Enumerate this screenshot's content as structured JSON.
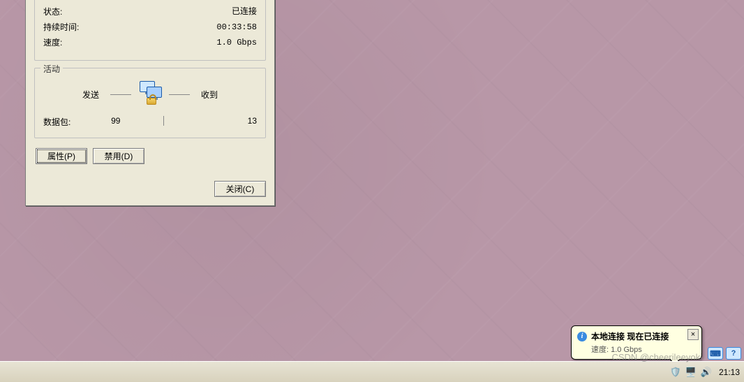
{
  "dialog": {
    "status_group": {
      "rows": {
        "status": {
          "label": "状态:",
          "value": "已连接"
        },
        "duration": {
          "label": "持续时间:",
          "value": "00:33:58"
        },
        "speed": {
          "label": "速度:",
          "value": "1.0 Gbps"
        }
      }
    },
    "activity_group": {
      "title": "活动",
      "sent_label": "发送",
      "recv_label": "收到",
      "packet_label": "数据包:",
      "sent_value": "99",
      "recv_value": "13"
    },
    "buttons": {
      "properties": "属性(P)",
      "disable": "禁用(D)",
      "close": "关闭(C)"
    }
  },
  "balloon": {
    "title": "本地连接 现在已连接",
    "subtitle": "速度: 1.0 Gbps",
    "close": "×"
  },
  "taskbar": {
    "clock": "21:13"
  },
  "watermark": "CSDN @cheerileeyoki"
}
